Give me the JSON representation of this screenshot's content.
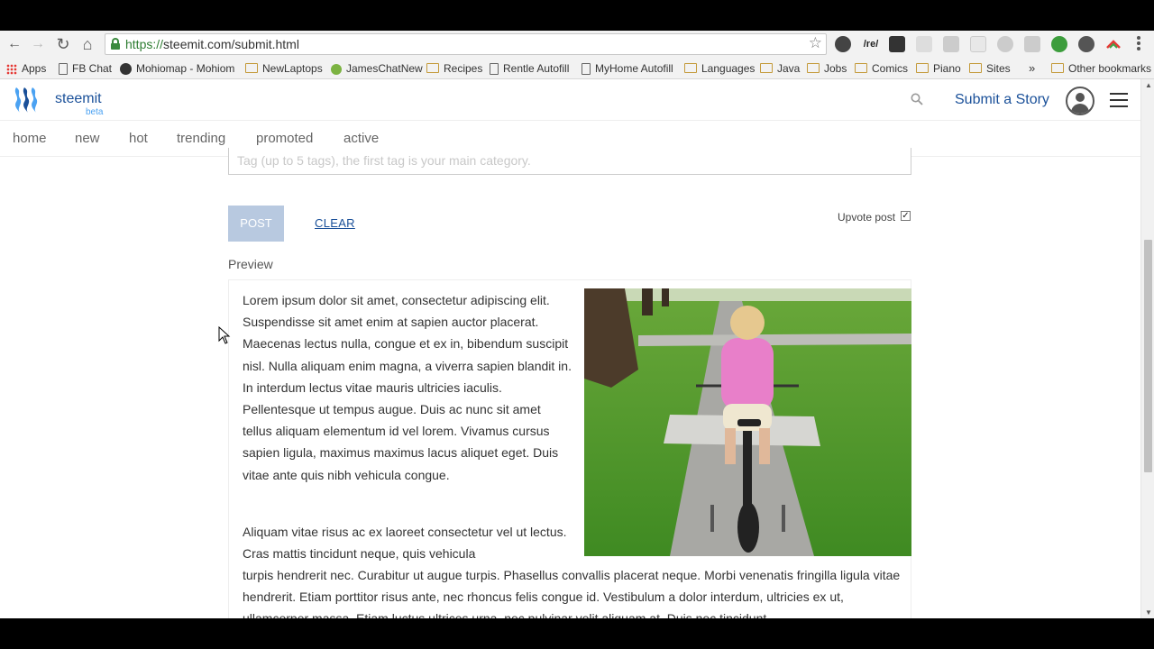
{
  "browser": {
    "url_scheme": "https://",
    "url_rest": "steemit.com/submit.html",
    "nav_back": "←",
    "nav_forward": "→",
    "nav_reload": "↻",
    "nav_home": "⌂",
    "bookmark_star": "☆",
    "ext_re": "/re/",
    "bookmarks_overflow": "»",
    "bookmarks": {
      "apps": "Apps",
      "fb_chat": "FB Chat",
      "mohiomap": "Mohiomap - Mohiom",
      "newlaptops": "NewLaptops",
      "jameschatnew": "JamesChatNew",
      "recipes": "Recipes",
      "rentle": "Rentle Autofill",
      "myhome": "MyHome Autofill",
      "languages": "Languages",
      "java": "Java",
      "jobs": "Jobs",
      "comics": "Comics",
      "piano": "Piano",
      "sites": "Sites",
      "other": "Other bookmarks"
    }
  },
  "header": {
    "brand": "steemit",
    "beta": "beta",
    "submit_story": "Submit a Story"
  },
  "subnav": {
    "home": "home",
    "new": "new",
    "hot": "hot",
    "trending": "trending",
    "promoted": "promoted",
    "active": "active"
  },
  "editor": {
    "tags_placeholder": "Tag (up to 5 tags), the first tag is your main category.",
    "post_label": "POST",
    "clear_label": "CLEAR",
    "upvote_label": "Upvote post",
    "upvote_checked": true,
    "preview_label": "Preview"
  },
  "preview": {
    "para1": "Lorem ipsum dolor sit amet, consectetur adipiscing elit. Suspendisse sit amet enim at sapien auctor placerat. Maecenas lectus nulla, congue et ex in, bibendum suscipit nisl. Nulla aliquam enim magna, a viverra sapien blandit in. In interdum lectus vitae mauris ultricies iaculis. Pellentesque ut tempus augue. Duis ac nunc sit amet tellus aliquam elementum id vel lorem. Vivamus cursus sapien ligula, maximus maximus lacus aliquet eget. Duis vitae ante quis nibh vehicula congue.",
    "para2_a": "Aliquam vitae risus ac ex laoreet consectetur vel ut lectus. Cras mattis tincidunt neque, quis vehicula",
    "para2_b": "turpis hendrerit nec. Curabitur ut augue turpis. Phasellus convallis placerat neque. Morbi venenatis fringilla ligula vitae hendrerit. Etiam porttitor risus ante, nec rhoncus felis congue id. Vestibulum a dolor interdum, ultricies ex ut, ullamcorper massa. Etiam luctus ultrices urna, nec pulvinar velit aliquam at. Duis nec tincidunt"
  },
  "colors": {
    "brand_blue": "#1a5099",
    "brand_light_blue": "#4ba2f2",
    "post_button": "#b8c9e0"
  }
}
